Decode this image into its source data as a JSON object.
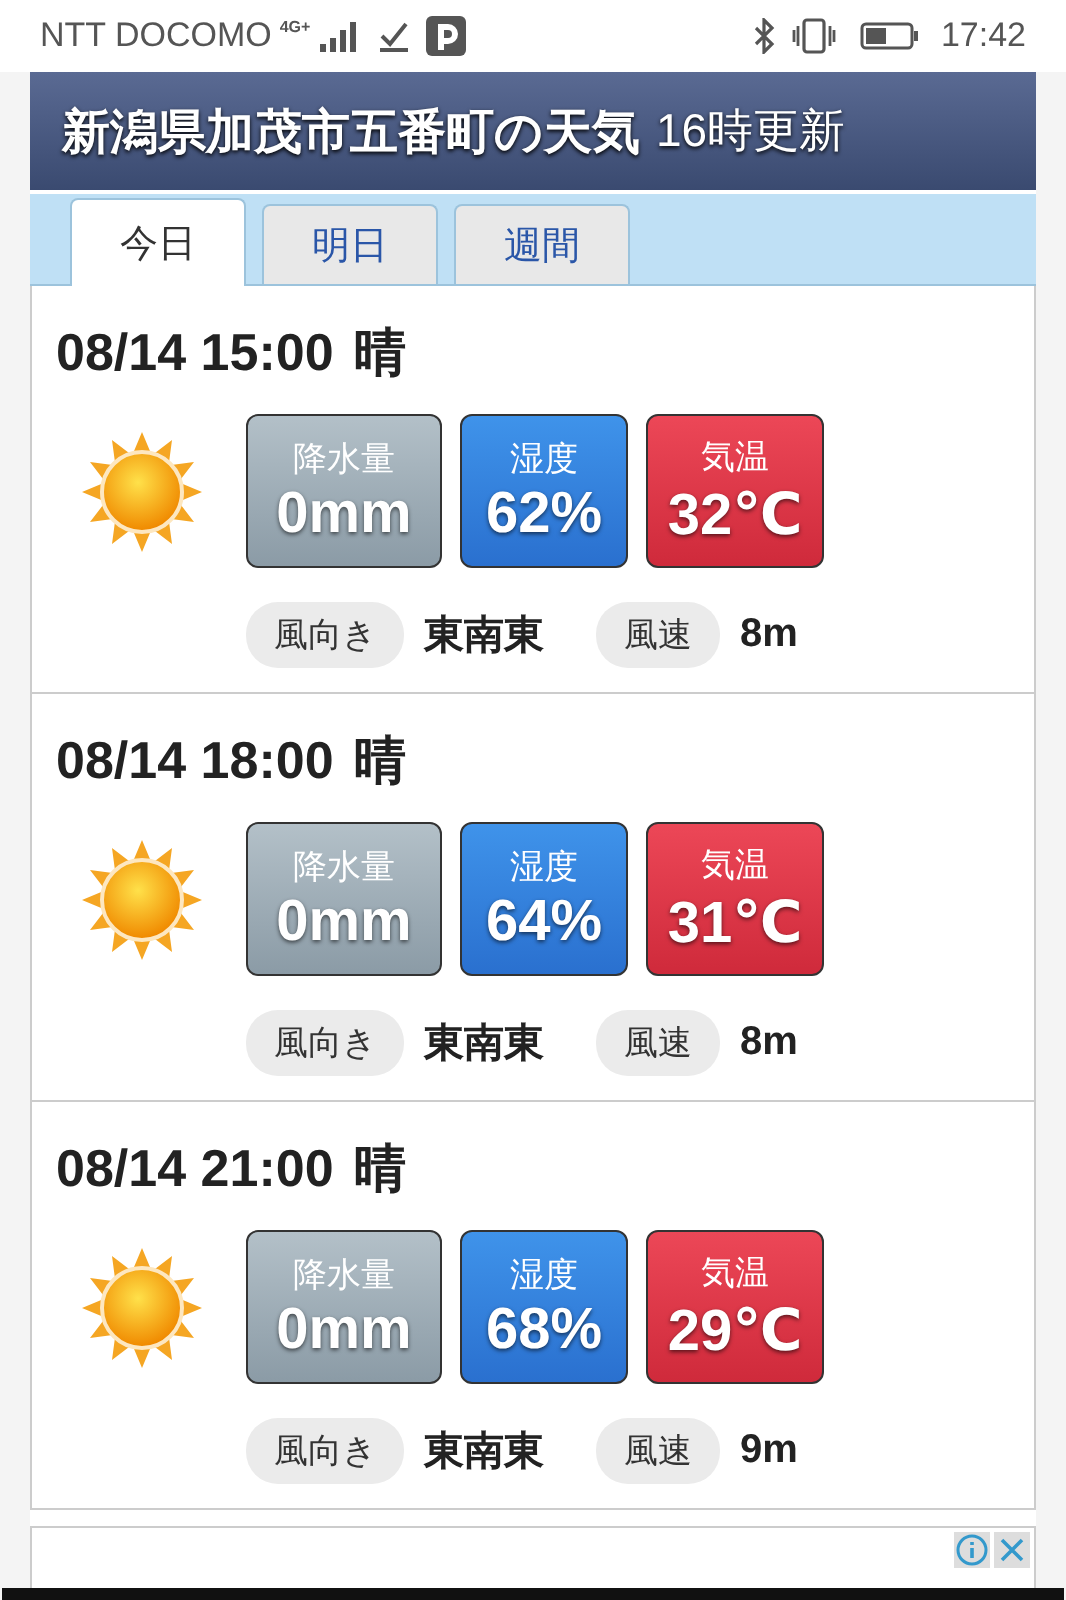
{
  "status_bar": {
    "carrier": "NTT DOCOMO",
    "network": "4G+",
    "time": "17:42"
  },
  "header": {
    "title": "新潟県加茂市五番町の天気",
    "updated": "16時更新"
  },
  "tabs": [
    {
      "label": "今日",
      "selected": true
    },
    {
      "label": "明日",
      "selected": false
    },
    {
      "label": "週間",
      "selected": false
    }
  ],
  "forecasts": [
    {
      "datetime": "08/14 15:00",
      "weather": "晴",
      "kind": "sunny",
      "metrics": [
        {
          "kind": "precipitation",
          "label": "降水量",
          "value": "0mm"
        },
        {
          "kind": "humidity",
          "label": "湿度",
          "value": "62%"
        },
        {
          "kind": "temperature",
          "label": "気温",
          "value": "32℃"
        }
      ],
      "wind_direction_label": "風向き",
      "wind_direction": "東南東",
      "wind_speed_label": "風速",
      "wind_speed": "8m"
    },
    {
      "datetime": "08/14 18:00",
      "weather": "晴",
      "kind": "sunny",
      "metrics": [
        {
          "kind": "precipitation",
          "label": "降水量",
          "value": "0mm"
        },
        {
          "kind": "humidity",
          "label": "湿度",
          "value": "64%"
        },
        {
          "kind": "temperature",
          "label": "気温",
          "value": "31℃"
        }
      ],
      "wind_direction_label": "風向き",
      "wind_direction": "東南東",
      "wind_speed_label": "風速",
      "wind_speed": "8m"
    },
    {
      "datetime": "08/14 21:00",
      "weather": "晴",
      "kind": "sunny",
      "metrics": [
        {
          "kind": "precipitation",
          "label": "降水量",
          "value": "0mm"
        },
        {
          "kind": "humidity",
          "label": "湿度",
          "value": "68%"
        },
        {
          "kind": "temperature",
          "label": "気温",
          "value": "29℃"
        }
      ],
      "wind_direction_label": "風向き",
      "wind_direction": "東南東",
      "wind_speed_label": "風速",
      "wind_speed": "9m"
    }
  ]
}
